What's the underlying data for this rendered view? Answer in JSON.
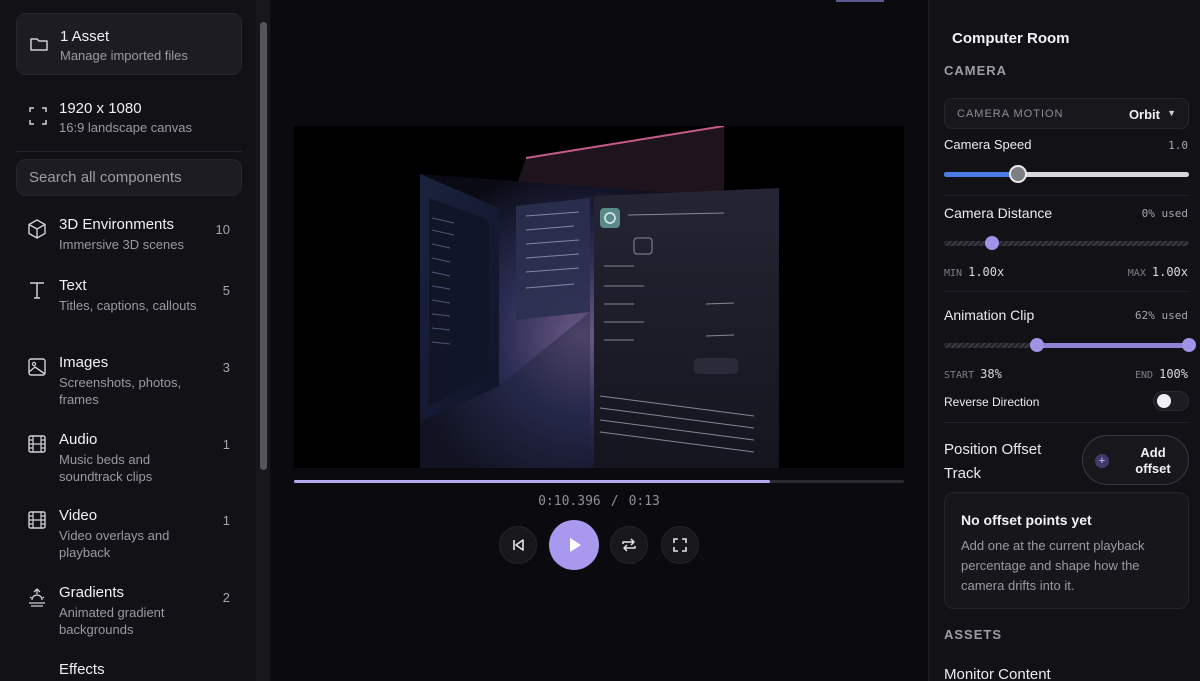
{
  "sidebar": {
    "asset": {
      "title": "1 Asset",
      "subtitle": "Manage imported files",
      "icon": "folder-icon"
    },
    "canvas": {
      "title": "1920 x 1080",
      "subtitle": "16:9 landscape canvas",
      "icon": "frame-icon"
    },
    "search": {
      "placeholder": "Search all components"
    },
    "categories": [
      {
        "name": "3D Environments",
        "desc": "Immersive 3D scenes",
        "count": "10",
        "icon": "cube-icon"
      },
      {
        "name": "Text",
        "desc": "Titles, captions, callouts",
        "count": "5",
        "icon": "text-icon"
      },
      {
        "name": "Images",
        "desc": "Screenshots, photos, frames",
        "count": "3",
        "icon": "image-icon"
      },
      {
        "name": "Audio",
        "desc": "Music beds and soundtrack clips",
        "count": "1",
        "icon": "film-icon"
      },
      {
        "name": "Video",
        "desc": "Video overlays and playback",
        "count": "1",
        "icon": "film-icon"
      },
      {
        "name": "Gradients",
        "desc": "Animated gradient backgrounds",
        "count": "2",
        "icon": "sunrise-icon"
      },
      {
        "name": "Effects",
        "desc": "",
        "count": "",
        "icon": "effects-icon"
      }
    ]
  },
  "player": {
    "current_time": "0:10.396",
    "separator": "/",
    "duration": "0:13",
    "progress_fraction": 0.78
  },
  "panel": {
    "title": "Computer Room",
    "camera_section": "CAMERA",
    "camera_motion_label": "CAMERA MOTION",
    "camera_motion_value": "Orbit",
    "camera_speed_label": "Camera Speed",
    "camera_speed_value": "1.0",
    "camera_speed_fraction": 0.3,
    "camera_distance_label": "Camera Distance",
    "camera_distance_used": "0% used",
    "camera_distance_min_label": "MIN",
    "camera_distance_min": "1.00x",
    "camera_distance_max_label": "MAX",
    "camera_distance_max": "1.00x",
    "animation_clip_label": "Animation Clip",
    "animation_clip_used": "62% used",
    "clip_start_label": "START",
    "clip_start": "38%",
    "clip_end_label": "END",
    "clip_end": "100%",
    "clip_start_fraction": 0.38,
    "clip_end_fraction": 1.0,
    "reverse_label": "Reverse Direction",
    "reverse_on": false,
    "position_offset_label": "Position Offset Track",
    "add_offset_label": "Add offset",
    "empty_title": "No offset points yet",
    "empty_desc": "Add one at the current playback percentage and shape how the camera drifts into it.",
    "assets_section": "ASSETS",
    "monitor_content_label": "Monitor Content"
  },
  "colors": {
    "accent": "#a898ee",
    "speed_fill": "#4a7be6",
    "clip_fill": "#8f84d6"
  }
}
